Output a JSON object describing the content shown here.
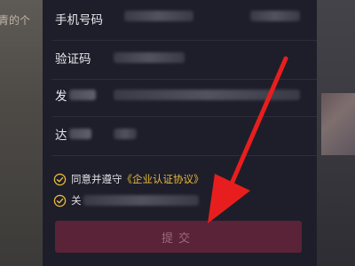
{
  "background": {
    "left_text": "青的个"
  },
  "form": {
    "phone_label": "手机号码",
    "code_label": "验证码",
    "field3_label": "发",
    "field4_label": "达"
  },
  "agreement": {
    "line1_prefix": "同意并遵守",
    "line1_link": "《企业认证协议》",
    "line2_prefix": "关"
  },
  "submit_label": "提交",
  "colors": {
    "accent": "#e8b93a",
    "submit_bg": "#5a2338",
    "arrow": "#e81e1e"
  }
}
